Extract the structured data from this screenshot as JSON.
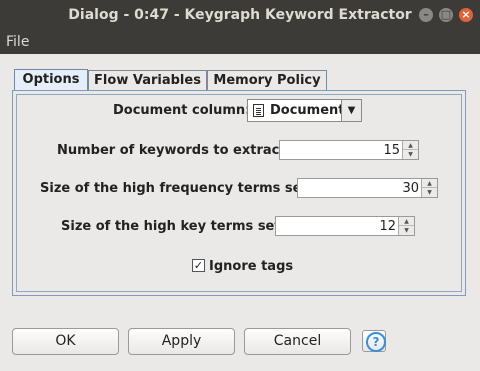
{
  "window": {
    "title": "Dialog - 0:47 - Keygraph Keyword Extractor",
    "controls": [
      "minimize-icon",
      "maximize-icon",
      "close-icon"
    ]
  },
  "menu": {
    "file": "File"
  },
  "tabs": [
    {
      "label": "Options",
      "active": true
    },
    {
      "label": "Flow Variables",
      "active": false
    },
    {
      "label": "Memory Policy",
      "active": false
    }
  ],
  "form": {
    "document_column_label": "Document column:",
    "document_column_value": "Document",
    "num_keywords_label": "Number of keywords to extract:",
    "num_keywords_value": "15",
    "high_freq_label": "Size of the high frequency terms set:",
    "high_freq_value": "30",
    "high_key_label": "Size of the high key terms set:",
    "high_key_value": "12",
    "ignore_tags_label": "Ignore tags",
    "ignore_tags_checked": true
  },
  "buttons": {
    "ok": "OK",
    "apply": "Apply",
    "cancel": "Cancel",
    "help": "?"
  },
  "colors": {
    "titlebar": "#3c3b37",
    "help_accent": "#3a8fd8"
  }
}
